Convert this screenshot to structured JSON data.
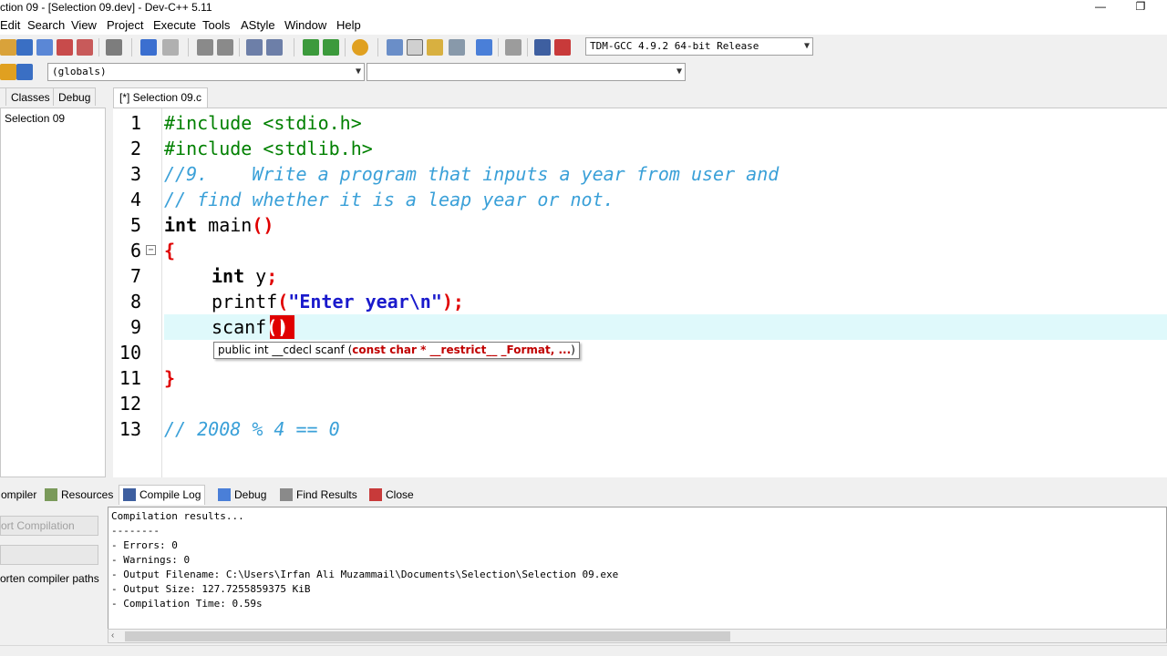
{
  "window": {
    "title": "ction 09 - [Selection 09.dev] - Dev-C++ 5.11",
    "minimize_glyph": "—",
    "restore_glyph": "❐"
  },
  "menu": [
    "Edit",
    "Search",
    "View",
    "Project",
    "Execute",
    "Tools",
    "AStyle",
    "Window",
    "Help"
  ],
  "toolbar": {
    "compiler_select": "TDM-GCC 4.9.2 64-bit Release",
    "scope_select": "(globals)",
    "function_select": ""
  },
  "left_panel": {
    "tabs": [
      "Classes",
      "Debug"
    ],
    "tree_item": "Selection 09"
  },
  "editor": {
    "tab_label": "[*] Selection 09.c",
    "line_numbers": [
      "1",
      "2",
      "3",
      "4",
      "5",
      "6",
      "7",
      "8",
      "9",
      "10",
      "11",
      "12",
      "13"
    ],
    "code": {
      "l1": "#include <stdio.h>",
      "l2": "#include <stdlib.h>",
      "l3": "//9.    Write a program that inputs a year from user and",
      "l4": "// find whether it is a leap year or not.",
      "l5_kw": "int",
      "l5_rest": " main",
      "l5_paren": "()",
      "l6": "{",
      "l7_kw": "int",
      "l7_rest": " y",
      "l7_semi": ";",
      "l8_fn": "printf",
      "l8_open": "(",
      "l8_str": "\"Enter year\\n\"",
      "l8_close": ");",
      "l9_fn": "scanf",
      "l9_paren": "()",
      "l11": "}",
      "l13": "// 2008 % 4 == 0"
    },
    "fold_glyph": "−",
    "tooltip_plain": "public int __cdecl scanf (",
    "tooltip_param": "const char * __restrict__ _Format, ...",
    "tooltip_end": ")"
  },
  "bottom_panel": {
    "tabs": [
      "ompiler",
      "Resources",
      "Compile Log",
      "Debug",
      "Find Results",
      "Close"
    ],
    "active_tab": "Compile Log",
    "abort_button": "ort Compilation",
    "shorten_paths": "orten compiler paths",
    "log": [
      "Compilation results...",
      "--------",
      "- Errors: 0",
      "- Warnings: 0",
      "- Output Filename: C:\\Users\\Irfan Ali Muzammail\\Documents\\Selection\\Selection 09.exe",
      "- Output Size: 127.7255859375 KiB",
      "- Compilation Time: 0.59s"
    ],
    "scroll_left_glyph": "‹"
  },
  "colors": {
    "preprocessor": "#008000",
    "comment": "#3aa0d8",
    "symbol": "#e00000",
    "string": "#1a1acc",
    "active_line": "#dff9fb"
  }
}
